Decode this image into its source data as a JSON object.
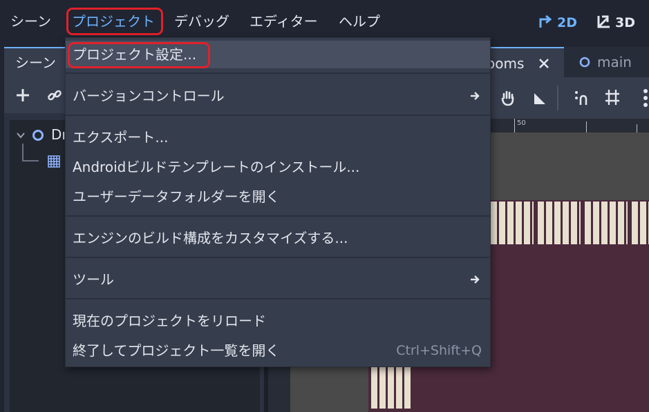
{
  "menubar": {
    "items": [
      "シーン",
      "プロジェクト",
      "デバッグ",
      "エディター",
      "ヘルプ"
    ],
    "mode_2d": "2D",
    "mode_3d": "3D"
  },
  "scene_dock": {
    "tab_label": "シーン",
    "root_node_partial": "Dı"
  },
  "editor_tabs": {
    "tab_rooms": "ooms",
    "tab_main": "main"
  },
  "ruler": {
    "label_50": "50"
  },
  "project_menu": {
    "items": [
      {
        "label": "プロジェクト設定..."
      },
      {
        "label": "バージョンコントロール"
      },
      {
        "label": "エクスポート..."
      },
      {
        "label": "Androidビルドテンプレートのインストール..."
      },
      {
        "label": "ユーザーデータフォルダーを開く"
      },
      {
        "label": "エンジンのビルド構成をカスタマイズする..."
      },
      {
        "label": "ツール"
      },
      {
        "label": "現在のプロジェクトをリロード"
      },
      {
        "label": "終了してプロジェクト一覧を開く",
        "shortcut": "Ctrl+Shift+Q"
      }
    ]
  },
  "colors": {
    "accent": "#6eb2ff",
    "highlight_annotation": "#e3202a",
    "menu_bg": "#363d4d",
    "editor_bg": "#202531",
    "tilemap_bg": "#4a2a3b"
  }
}
